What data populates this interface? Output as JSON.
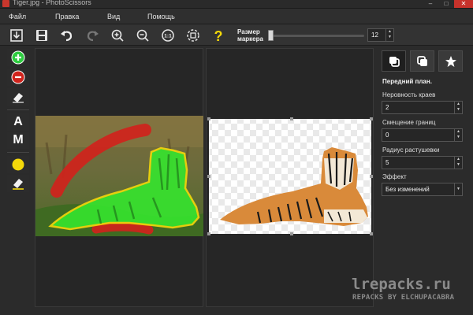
{
  "window": {
    "title": "Tiger.jpg - PhotoScissors",
    "minimize": "–",
    "maximize": "□",
    "close": "✕"
  },
  "menu": [
    "Файл",
    "Правка",
    "Вид",
    "Помощь"
  ],
  "toolbar": {
    "icons": [
      "open-icon",
      "save-icon",
      "undo-icon",
      "redo-icon",
      "zoom-in-icon",
      "zoom-out-icon",
      "actual-size-icon",
      "fit-to-window-icon",
      "help-icon"
    ],
    "actual_size_label": "1:1",
    "help_label": "?",
    "marker_label_line1": "Размер",
    "marker_label_line2": "маркера",
    "marker_size": "12",
    "marker_slider_fraction": 0.02
  },
  "left_tools": {
    "icons": [
      "add-marker-icon",
      "remove-marker-icon",
      "eraser-icon",
      "auto-mode",
      "manual-mode",
      "edge-marker-icon",
      "edge-eraser-icon"
    ],
    "auto_label": "A",
    "manual_label": "M"
  },
  "right_panel": {
    "tabs": [
      "foreground-tab",
      "background-tab",
      "effects-tab"
    ],
    "heading": "Передний план.",
    "edge_roughness_label": "Неровность краев",
    "edge_roughness_value": "2",
    "border_offset_label": "Смещение границ",
    "border_offset_value": "0",
    "feather_radius_label": "Радиус растушевки",
    "feather_radius_value": "5",
    "effect_label": "Эффект",
    "effect_value": "Без изменений"
  },
  "watermark": {
    "main": "lrepacks.ru",
    "sub": "REPACKS BY ELCHUPACABRA"
  },
  "colors": {
    "accent_green": "#2ecc40",
    "accent_red": "#d0231c",
    "marker_yellow": "#f5d90a",
    "close_red": "#c7322b"
  }
}
